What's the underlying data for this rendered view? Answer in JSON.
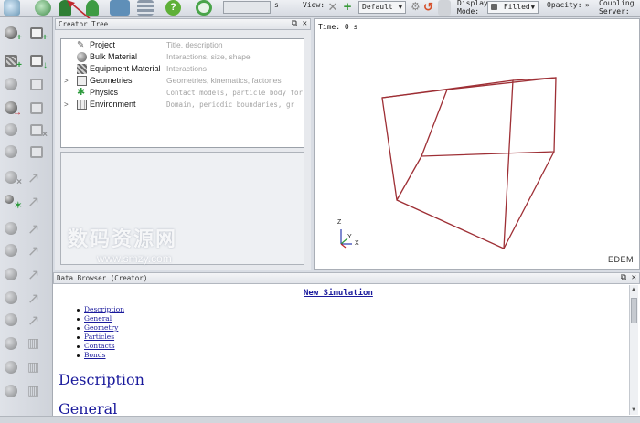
{
  "toolbar": {
    "time_unit": "s",
    "view_label": "View:",
    "view_preset": "Default",
    "display_mode_label": "Display Mode:",
    "display_mode_value": "Filled",
    "opacity_label": "Opacity:",
    "coupling_label": "Coupling Server:"
  },
  "creator": {
    "title": "Creator Tree",
    "items": [
      {
        "label": "Project",
        "desc": "Title, description",
        "icon": "pencil-icon",
        "expandable": false
      },
      {
        "label": "Bulk Material",
        "desc": "Interactions, size, shape",
        "icon": "sphere-icon",
        "expandable": false
      },
      {
        "label": "Equipment Material",
        "desc": "Interactions",
        "icon": "hatched-square-icon",
        "expandable": false
      },
      {
        "label": "Geometries",
        "desc": "Geometries, kinematics, factories",
        "icon": "box-icon",
        "expandable": true
      },
      {
        "label": "Physics",
        "desc": "Contact models, particle body for",
        "icon": "physics-icon",
        "expandable": false
      },
      {
        "label": "Environment",
        "desc": "Domain, periodic boundaries, gr",
        "icon": "environment-icon",
        "expandable": true
      }
    ]
  },
  "viewport": {
    "time_label": "Time: 0 s",
    "logo": "EDEM",
    "axes": {
      "z": "Z",
      "y": "Y",
      "x": "X"
    }
  },
  "browser": {
    "title": "Data Browser (Creator)",
    "doc_title": "New Simulation",
    "links": [
      "Description",
      "General",
      "Geometry",
      "Particles",
      "Contacts",
      "Bonds"
    ],
    "heading1": "Description",
    "heading2": "General"
  },
  "watermark": {
    "text": "数码资源网",
    "url": "www.smzy.com"
  },
  "colors": {
    "accent_green": "#2c9a3c",
    "cube_edges": "#9e2f35",
    "link_blue": "#1a1a9c"
  }
}
